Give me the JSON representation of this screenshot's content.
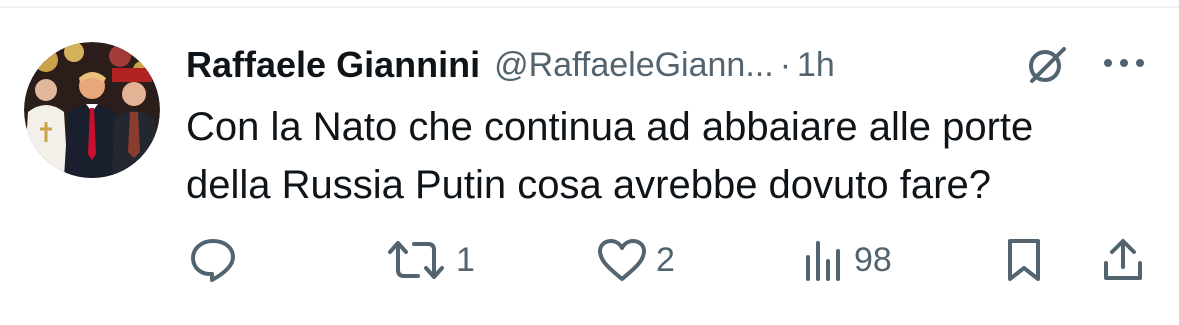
{
  "tweet": {
    "author": {
      "display_name": "Raffaele Giannini",
      "handle": "@RaffaeleGiann...",
      "separator": "·",
      "time": "1h",
      "avatar_icon": "avatar-photo-icon"
    },
    "text_lines": [
      "Con la Nato che continua ad abbaiare alle porte",
      "della Russia Putin cosa avrebbe dovuto fare?"
    ],
    "header_icons": [
      "grok-icon",
      "more-icon"
    ],
    "actions": {
      "reply": {
        "icon": "reply-icon",
        "count": ""
      },
      "retweet": {
        "icon": "retweet-icon",
        "count": "1"
      },
      "like": {
        "icon": "heart-icon",
        "count": "2"
      },
      "views": {
        "icon": "views-chart-icon",
        "count": "98"
      },
      "bookmark": {
        "icon": "bookmark-icon"
      },
      "share": {
        "icon": "share-icon"
      }
    }
  },
  "colors": {
    "text_primary": "#0f1419",
    "text_secondary": "#536471",
    "divider": "#eff3f4"
  }
}
